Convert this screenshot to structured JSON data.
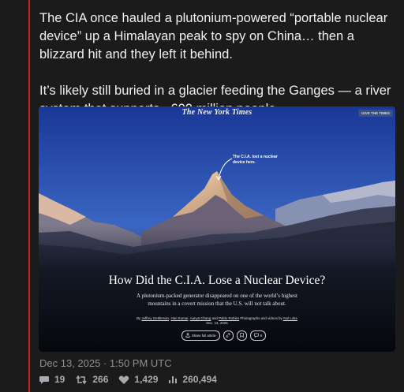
{
  "post": {
    "text": "The CIA once hauled a plutonium-powered “portable nuclear device” up a Himalayan peak to spy on China… then a blizzard hit and they left it behind.\n\nIt’s likely still buried in a glacier feeding the Ganges — a river system that supports ~600 million people.",
    "timestamp": "Dec 13, 2025 · 1:50 PM UTC"
  },
  "card": {
    "masthead": "The New York Times",
    "give_label": "GIVE THE TIMES",
    "annotation": "The C.I.A. lost a nuclear device here.",
    "headline": "How Did the C.I.A. Lose a Nuclear Device?",
    "dek": "A plutonium-packed generator disappeared on one of the world’s highest mountains in a covert mission that the U.S. will not talk about.",
    "byline_prefix": "By",
    "authors": [
      "Jeffrey Gettleman",
      "Hari Kumar",
      "Aanya Chang",
      "Pablo Robles"
    ],
    "byline_sep1": ",",
    "byline_and": "and",
    "byline_photo": "Photographs and videos by",
    "photographer": "Atul Loke",
    "date": "Dec. 13, 2025",
    "share_label": "Share full article",
    "comment_count": "6"
  },
  "stats": {
    "replies": "19",
    "reposts": "266",
    "likes": "1,429",
    "views": "260,494"
  },
  "colors": {
    "thread_line": "#c91f1f",
    "background": "#1b1b1b",
    "sky_top": "#1f3fa0",
    "sky_bottom": "#6d93d8"
  },
  "icons": [
    "reply-icon",
    "repost-icon",
    "heart-icon",
    "views-icon",
    "share-icon",
    "link-icon",
    "bookmark-icon",
    "comment-icon",
    "arrow-icon"
  ]
}
